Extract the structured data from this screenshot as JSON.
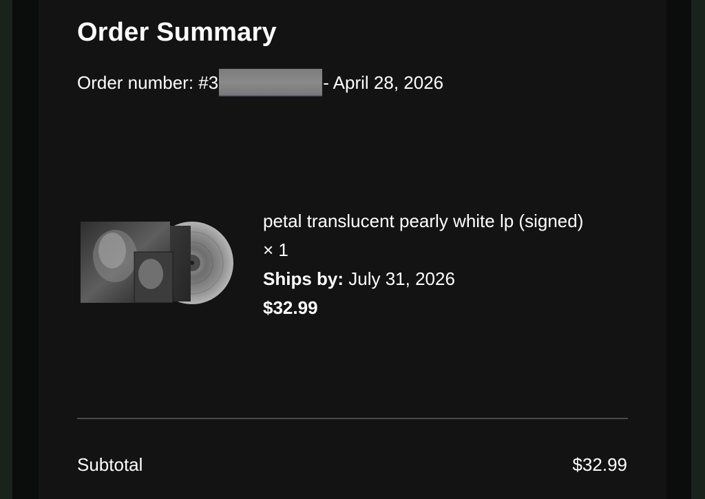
{
  "order_summary": {
    "title": "Order Summary",
    "order_prefix": "Order number: #3",
    "order_suffix": "- April 28, 2026"
  },
  "item": {
    "name": "petal translucent pearly white lp (signed)",
    "quantity": "× 1",
    "ships_label": "Ships by:",
    "ships_date": "July 31, 2026",
    "price": "$32.99"
  },
  "totals": {
    "subtotal_label": "Subtotal",
    "subtotal_value": "$32.99"
  }
}
